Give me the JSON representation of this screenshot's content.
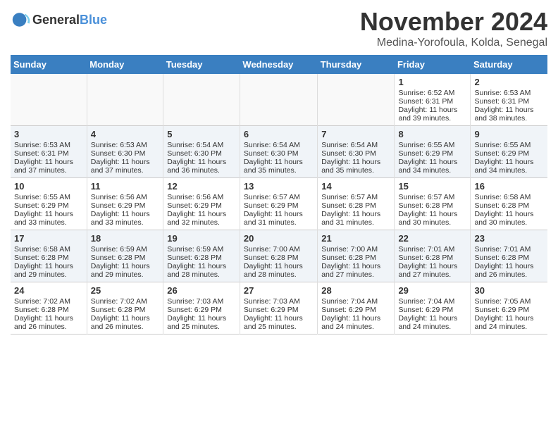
{
  "logo": {
    "general": "General",
    "blue": "Blue"
  },
  "title": "November 2024",
  "location": "Medina-Yorofoula, Kolda, Senegal",
  "days_header": [
    "Sunday",
    "Monday",
    "Tuesday",
    "Wednesday",
    "Thursday",
    "Friday",
    "Saturday"
  ],
  "rows": [
    [
      {
        "day": "",
        "info": ""
      },
      {
        "day": "",
        "info": ""
      },
      {
        "day": "",
        "info": ""
      },
      {
        "day": "",
        "info": ""
      },
      {
        "day": "",
        "info": ""
      },
      {
        "day": "1",
        "info": "Sunrise: 6:52 AM\nSunset: 6:31 PM\nDaylight: 11 hours and 39 minutes."
      },
      {
        "day": "2",
        "info": "Sunrise: 6:53 AM\nSunset: 6:31 PM\nDaylight: 11 hours and 38 minutes."
      }
    ],
    [
      {
        "day": "3",
        "info": "Sunrise: 6:53 AM\nSunset: 6:31 PM\nDaylight: 11 hours and 37 minutes."
      },
      {
        "day": "4",
        "info": "Sunrise: 6:53 AM\nSunset: 6:30 PM\nDaylight: 11 hours and 37 minutes."
      },
      {
        "day": "5",
        "info": "Sunrise: 6:54 AM\nSunset: 6:30 PM\nDaylight: 11 hours and 36 minutes."
      },
      {
        "day": "6",
        "info": "Sunrise: 6:54 AM\nSunset: 6:30 PM\nDaylight: 11 hours and 35 minutes."
      },
      {
        "day": "7",
        "info": "Sunrise: 6:54 AM\nSunset: 6:30 PM\nDaylight: 11 hours and 35 minutes."
      },
      {
        "day": "8",
        "info": "Sunrise: 6:55 AM\nSunset: 6:29 PM\nDaylight: 11 hours and 34 minutes."
      },
      {
        "day": "9",
        "info": "Sunrise: 6:55 AM\nSunset: 6:29 PM\nDaylight: 11 hours and 34 minutes."
      }
    ],
    [
      {
        "day": "10",
        "info": "Sunrise: 6:55 AM\nSunset: 6:29 PM\nDaylight: 11 hours and 33 minutes."
      },
      {
        "day": "11",
        "info": "Sunrise: 6:56 AM\nSunset: 6:29 PM\nDaylight: 11 hours and 33 minutes."
      },
      {
        "day": "12",
        "info": "Sunrise: 6:56 AM\nSunset: 6:29 PM\nDaylight: 11 hours and 32 minutes."
      },
      {
        "day": "13",
        "info": "Sunrise: 6:57 AM\nSunset: 6:29 PM\nDaylight: 11 hours and 31 minutes."
      },
      {
        "day": "14",
        "info": "Sunrise: 6:57 AM\nSunset: 6:28 PM\nDaylight: 11 hours and 31 minutes."
      },
      {
        "day": "15",
        "info": "Sunrise: 6:57 AM\nSunset: 6:28 PM\nDaylight: 11 hours and 30 minutes."
      },
      {
        "day": "16",
        "info": "Sunrise: 6:58 AM\nSunset: 6:28 PM\nDaylight: 11 hours and 30 minutes."
      }
    ],
    [
      {
        "day": "17",
        "info": "Sunrise: 6:58 AM\nSunset: 6:28 PM\nDaylight: 11 hours and 29 minutes."
      },
      {
        "day": "18",
        "info": "Sunrise: 6:59 AM\nSunset: 6:28 PM\nDaylight: 11 hours and 29 minutes."
      },
      {
        "day": "19",
        "info": "Sunrise: 6:59 AM\nSunset: 6:28 PM\nDaylight: 11 hours and 28 minutes."
      },
      {
        "day": "20",
        "info": "Sunrise: 7:00 AM\nSunset: 6:28 PM\nDaylight: 11 hours and 28 minutes."
      },
      {
        "day": "21",
        "info": "Sunrise: 7:00 AM\nSunset: 6:28 PM\nDaylight: 11 hours and 27 minutes."
      },
      {
        "day": "22",
        "info": "Sunrise: 7:01 AM\nSunset: 6:28 PM\nDaylight: 11 hours and 27 minutes."
      },
      {
        "day": "23",
        "info": "Sunrise: 7:01 AM\nSunset: 6:28 PM\nDaylight: 11 hours and 26 minutes."
      }
    ],
    [
      {
        "day": "24",
        "info": "Sunrise: 7:02 AM\nSunset: 6:28 PM\nDaylight: 11 hours and 26 minutes."
      },
      {
        "day": "25",
        "info": "Sunrise: 7:02 AM\nSunset: 6:28 PM\nDaylight: 11 hours and 26 minutes."
      },
      {
        "day": "26",
        "info": "Sunrise: 7:03 AM\nSunset: 6:29 PM\nDaylight: 11 hours and 25 minutes."
      },
      {
        "day": "27",
        "info": "Sunrise: 7:03 AM\nSunset: 6:29 PM\nDaylight: 11 hours and 25 minutes."
      },
      {
        "day": "28",
        "info": "Sunrise: 7:04 AM\nSunset: 6:29 PM\nDaylight: 11 hours and 24 minutes."
      },
      {
        "day": "29",
        "info": "Sunrise: 7:04 AM\nSunset: 6:29 PM\nDaylight: 11 hours and 24 minutes."
      },
      {
        "day": "30",
        "info": "Sunrise: 7:05 AM\nSunset: 6:29 PM\nDaylight: 11 hours and 24 minutes."
      }
    ]
  ]
}
